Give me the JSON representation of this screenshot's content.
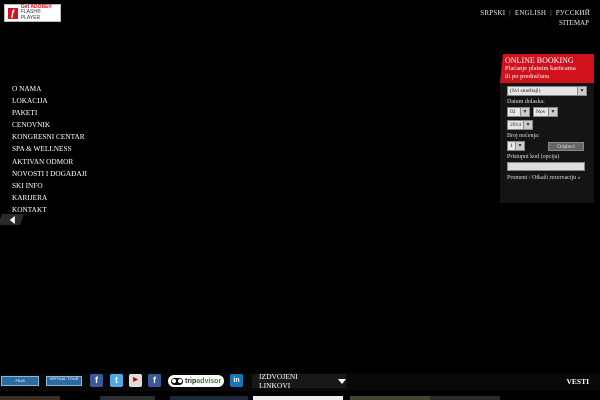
{
  "flash_badge": {
    "line1": "Get ADOBE®",
    "line2": "FLASH® PLAYER"
  },
  "languages": [
    "SRPSKI",
    "ENGLISH",
    "РУССКИЙ"
  ],
  "sitemap": "SITEMAP",
  "menu": [
    "O NAMA",
    "LOKACIJA",
    "PAKETI",
    "CENOVNIK",
    "KONGRESNI CENTAR",
    "SPA & WELLNESS",
    "AKTIVAN ODMOR",
    "NOVOSTI I DOGAĐAJI",
    "SKI INFO",
    "KARIJERA",
    "KONTAKT"
  ],
  "booking": {
    "title": "ONLINE BOOKING",
    "subtitle_1": "Plaćanje platnim karticama",
    "subtitle_2": "ili po predračunu",
    "property_value": "(Svi smeštaji)",
    "arrival_label": "Datum dolaska:",
    "day_value": "02",
    "month_value": "Nov",
    "year_value": "2014",
    "nights_label": "Broj noćenja:",
    "nights_value": "1",
    "select_button": "Odaberi",
    "access_code_label": "Pristupni kod (opcija)",
    "links": "Promeni / Otkaži rezervaciju »"
  },
  "bottom": {
    "film_button": "FILM",
    "virtual_tour_button": "VIRTUAL TOUR",
    "tripadvisor_1": "trip",
    "tripadvisor_2": "advisor",
    "featured_links": "IZDVOJENI LINKOVI",
    "news": "VESTI"
  },
  "colors": {
    "accent": "#d1121c",
    "background": "#000000"
  }
}
